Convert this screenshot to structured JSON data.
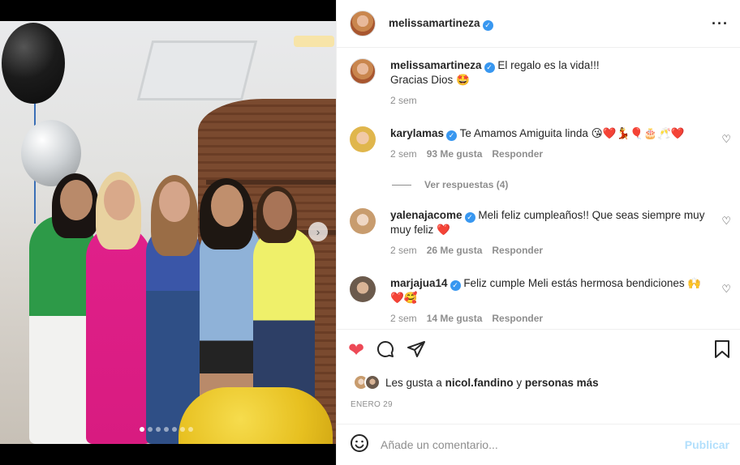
{
  "post": {
    "author": "melissamartineza",
    "caption_line1": "El regalo es la vida!!!",
    "caption_line2": "Gracias Dios 🤩",
    "caption_time": "2 sem",
    "carousel_dots": 7,
    "carousel_active_index": 0
  },
  "comments": [
    {
      "user": "karylamas",
      "text": "Te Amamos Amiguita linda 😘❤️💃🎈🎂🥂❤️",
      "time": "2 sem",
      "likes": "93 Me gusta",
      "reply": "Responder",
      "view_replies": "Ver respuestas (4)"
    },
    {
      "user": "yalenajacome",
      "text": "Meli feliz cumpleaños!! Que seas siempre muy muy feliz ❤️",
      "time": "2 sem",
      "likes": "26 Me gusta",
      "reply": "Responder"
    },
    {
      "user": "marjajua14",
      "text": "Feliz cumple Meli estás hermosa bendiciones 🙌 ❤️🥰",
      "time": "2 sem",
      "likes": "14 Me gusta",
      "reply": "Responder"
    }
  ],
  "likes": {
    "prefix": "Les gusta a",
    "user": "nicol.fandino",
    "joiner": "y",
    "suffix": "personas más"
  },
  "date": "ENERO 29",
  "composer": {
    "placeholder": "Añade un comentario...",
    "post_label": "Publicar"
  },
  "icons": {
    "more": "more-horizontal-icon",
    "like": "heart-filled-icon",
    "comment": "comment-icon",
    "share": "share-icon",
    "save": "bookmark-icon",
    "emoji": "emoji-icon",
    "next": "chevron-right-icon"
  },
  "colors": {
    "liked_heart": "#ed4956",
    "verified": "#3897f0",
    "post_button_disabled": "#b2dffc"
  }
}
